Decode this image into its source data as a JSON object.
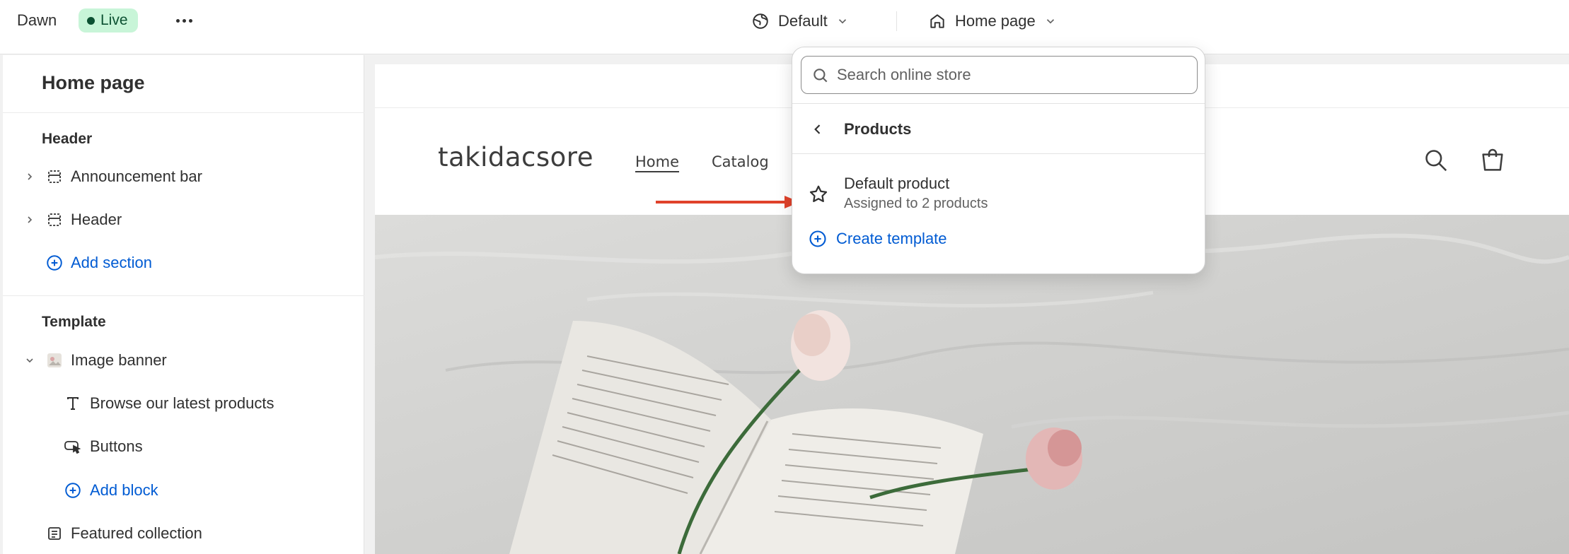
{
  "topbar": {
    "theme_name": "Dawn",
    "live_badge": "Live",
    "language_select": "Default",
    "page_select": "Home page"
  },
  "sidebar": {
    "title": "Home page",
    "header_group": {
      "heading": "Header",
      "items": [
        "Announcement bar",
        "Header"
      ],
      "add_section": "Add section"
    },
    "template_group": {
      "heading": "Template",
      "section": "Image banner",
      "blocks": [
        "Browse our latest products",
        "Buttons"
      ],
      "add_block": "Add block",
      "next_section": "Featured collection"
    }
  },
  "preview": {
    "store_name": "takidacsore",
    "nav": [
      "Home",
      "Catalog"
    ]
  },
  "popover": {
    "search_placeholder": "Search online store",
    "section_title": "Products",
    "item_title": "Default product",
    "item_subtitle": "Assigned to 2 products",
    "create_label": "Create template"
  },
  "colors": {
    "accent_link": "#005bd3",
    "live_badge_bg": "#c8f5d8",
    "annotation_arrow": "#e0422b"
  }
}
